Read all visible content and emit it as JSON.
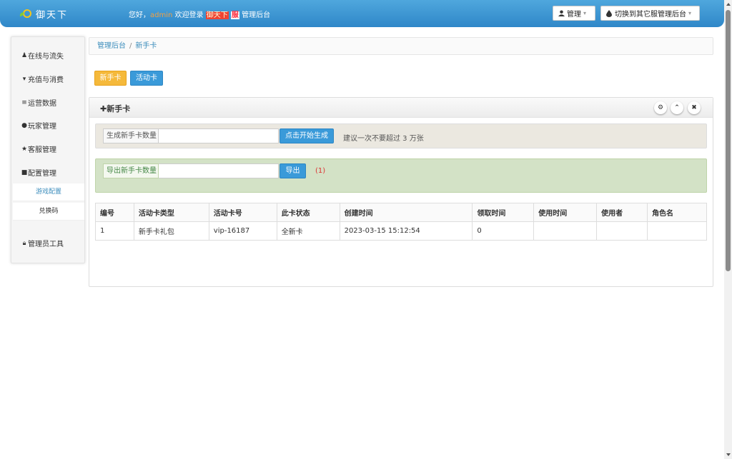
{
  "header": {
    "logo_text": "御天下",
    "welcome_prefix": "您好，",
    "username": "admin",
    "welcome_mid": " 欢迎登录 ",
    "game_name": "御天下",
    "server_mark": "服",
    "welcome_suffix": " 管理后台",
    "admin_menu_label": "管理",
    "switch_server_label": "切换到其它服管理后台"
  },
  "sidebar": {
    "items": [
      {
        "icon": "user-icon",
        "label": "在线与流失"
      },
      {
        "icon": "cart-icon",
        "label": "充值与消费"
      },
      {
        "icon": "list-icon",
        "label": "运营数据"
      },
      {
        "icon": "person-icon",
        "label": "玩家管理"
      },
      {
        "icon": "star-icon",
        "label": "客服管理"
      },
      {
        "icon": "book-icon",
        "label": "配置管理"
      },
      {
        "icon": "lock-icon",
        "label": "管理员工具"
      }
    ],
    "sub_items": [
      "游戏配置",
      "兑换码"
    ]
  },
  "breadcrumb": {
    "root": "管理后台",
    "separator": "/",
    "current": "新手卡"
  },
  "tabs": {
    "new_card": "新手卡",
    "activity_card": "活动卡"
  },
  "panel": {
    "title": "新手卡",
    "generate": {
      "label": "生成新手卡数量",
      "value": "",
      "button": "点击开始生成",
      "hint": "建议一次不要超过 3 万张"
    },
    "export": {
      "label": "导出新手卡数量",
      "value": "",
      "button": "导出",
      "count": "(1)"
    }
  },
  "table": {
    "columns": [
      "编号",
      "活动卡类型",
      "活动卡号",
      "此卡状态",
      "创建时间",
      "领取时间",
      "使用时间",
      "使用者",
      "角色名"
    ],
    "rows": [
      [
        "1",
        "新手卡礼包",
        "vip-16187",
        "全新卡",
        "2023-03-15 15:12:54",
        "0",
        "",
        "",
        ""
      ]
    ]
  },
  "colors": {
    "header_blue": "#3a96d4",
    "tab_new_orange": "#f5b93b",
    "button_blue": "#3a9ad9",
    "export_well_green": "#d3e2c6",
    "count_red": "#d33333"
  }
}
